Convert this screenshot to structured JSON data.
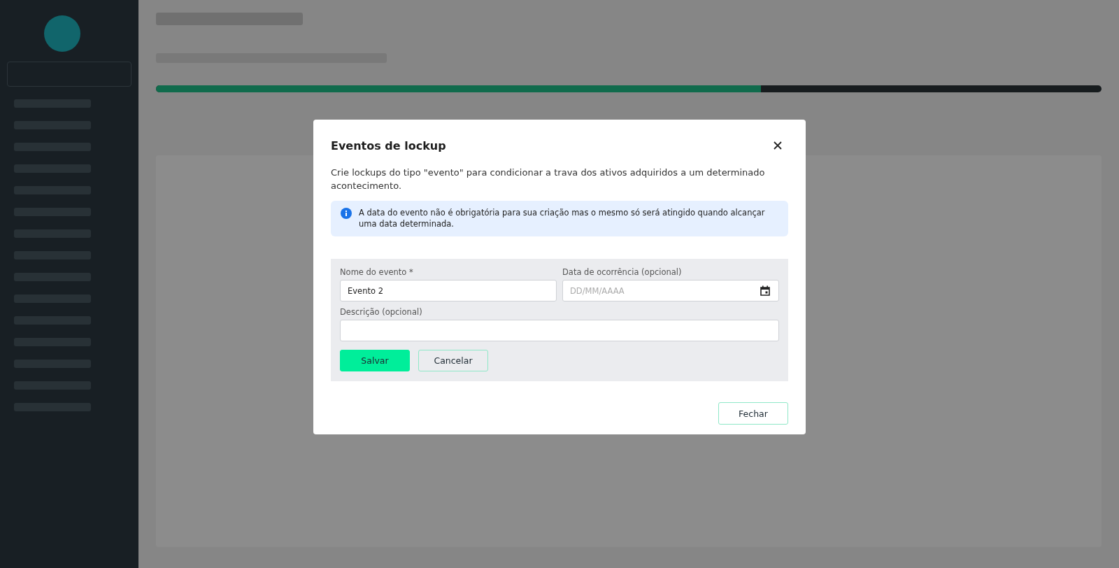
{
  "background": {
    "progress": {
      "level": 0.64
    }
  },
  "modal": {
    "title": "Eventos de lockup",
    "description": "Crie lockups do tipo \"evento\" para condicionar a trava dos ativos adquiridos a um determinado acontecimento.",
    "info": "A data do evento não é obrigatória para sua criação mas o mesmo só será atingido quando alcançar uma data determinada.",
    "form": {
      "fields": [
        {
          "kind": "text",
          "label": "Nome do evento *",
          "value": "Evento 2"
        },
        {
          "kind": "date",
          "label": "Data de ocorrência (opcional)",
          "placeholder": "DD/MM/AAAA"
        },
        {
          "kind": "wide",
          "label": "Descrição (opcional)"
        }
      ],
      "buttons": [
        {
          "kind": "primary",
          "label": "Salvar"
        },
        {
          "kind": "secondary",
          "label": "Cancelar"
        }
      ]
    },
    "footer_button": "Fechar"
  }
}
